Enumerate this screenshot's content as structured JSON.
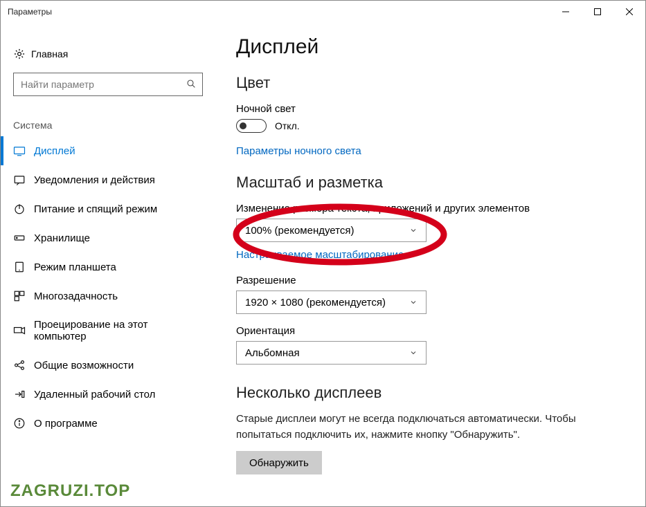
{
  "window": {
    "title": "Параметры"
  },
  "sidebar": {
    "home": "Главная",
    "search_placeholder": "Найти параметр",
    "section": "Система",
    "items": [
      {
        "label": "Дисплей"
      },
      {
        "label": "Уведомления и действия"
      },
      {
        "label": "Питание и спящий режим"
      },
      {
        "label": "Хранилище"
      },
      {
        "label": "Режим планшета"
      },
      {
        "label": "Многозадачность"
      },
      {
        "label": "Проецирование на этот компьютер"
      },
      {
        "label": "Общие возможности"
      },
      {
        "label": "Удаленный рабочий стол"
      },
      {
        "label": "О программе"
      }
    ]
  },
  "main": {
    "title": "Дисплей",
    "section_color": "Цвет",
    "night_light_label": "Ночной свет",
    "toggle_state": "Откл.",
    "night_light_settings_link": "Параметры ночного света",
    "section_scale": "Масштаб и разметка",
    "scale_label": "Изменение размера текста, приложений и других элементов",
    "scale_value": "100% (рекомендуется)",
    "custom_scale_link": "Настраиваемое масштабирование",
    "resolution_label": "Разрешение",
    "resolution_value": "1920 × 1080 (рекомендуется)",
    "orientation_label": "Ориентация",
    "orientation_value": "Альбомная",
    "section_multi": "Несколько дисплеев",
    "multi_text1": "Старые дисплеи могут не всегда подключаться автоматически. Чтобы попытаться подключить их, нажмите кнопку \"Обнаружить\".",
    "detect_button": "Обнаружить"
  },
  "watermark": "ZAGRUZI.TOP"
}
